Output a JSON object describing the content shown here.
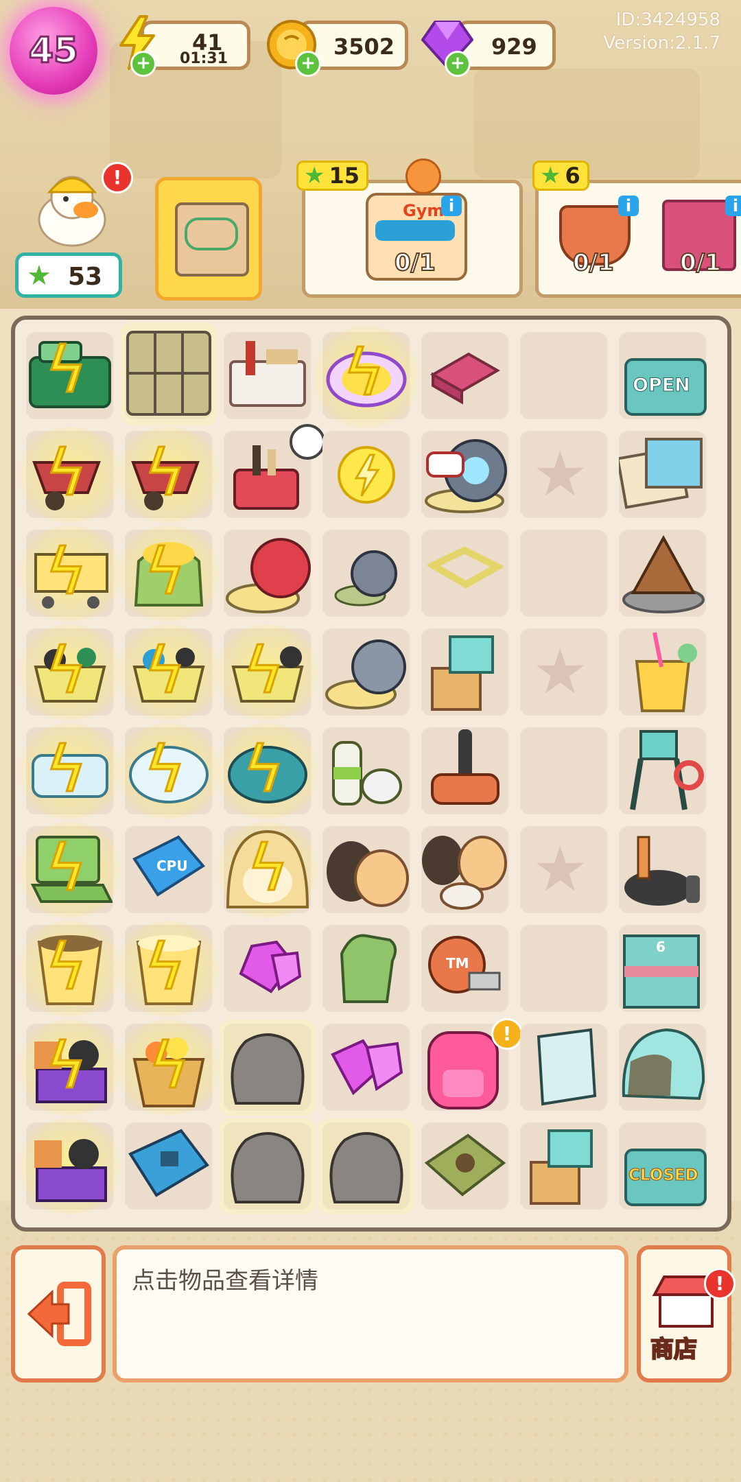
{
  "top_bar": {
    "level": "45",
    "energy": {
      "value": "41",
      "timer": "01:31",
      "icon": "lightning-icon"
    },
    "coins": {
      "value": "3502",
      "icon": "coin-icon"
    },
    "gems": {
      "value": "929",
      "icon": "gem-icon"
    },
    "plus_label": "+"
  },
  "account": {
    "id_text": "ID:3424958",
    "version_text": "Version:2.1.7"
  },
  "player": {
    "stars": "53",
    "avatar": "duck-builder-avatar",
    "alert": "!"
  },
  "orders": [
    {
      "reward": "15",
      "item": "fatgoose-gym-sign",
      "progress": "0/1",
      "info": "i"
    },
    {
      "reward": "6",
      "items": [
        {
          "name": "clay-pot",
          "progress": "0/1",
          "info": "i"
        },
        {
          "name": "brick-pallet",
          "progress": "0/1",
          "info": "i"
        }
      ]
    }
  ],
  "board": {
    "cpu_label": "CPU",
    "open_sign": "OPEN",
    "closed_sign": "CLOSED",
    "gym_sign_text": "Gym",
    "mini_labels": {
      "tool": "TM",
      "building": "6"
    }
  },
  "bottom": {
    "hint": "点击物品查看详情",
    "shop_label": "商店",
    "alert": "!"
  },
  "colors": {
    "energy": "#ffe62b",
    "coin": "#f6b21b",
    "gem": "#b24bea",
    "star": "#4fb935",
    "level_badge": "#e53cb8"
  }
}
